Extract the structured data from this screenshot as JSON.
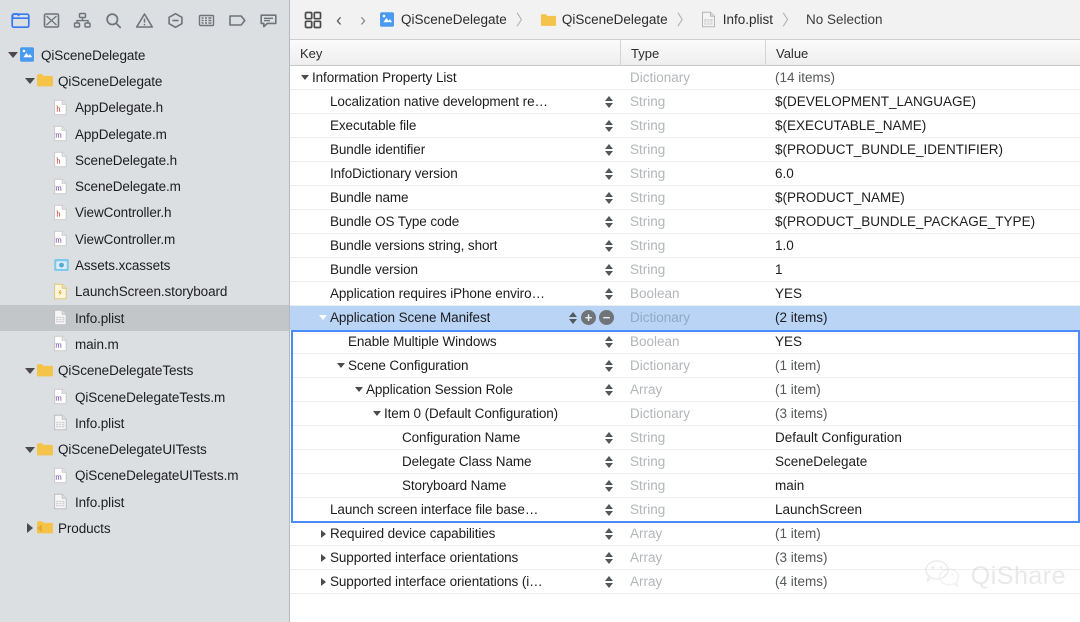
{
  "navigator": {
    "toolbar_tabs": [
      {
        "name": "project-navigator-icon",
        "label": "Project Navigator",
        "active": true
      },
      {
        "name": "source-control-navigator-icon",
        "label": "Source Control Navigator",
        "active": false
      },
      {
        "name": "symbol-navigator-icon",
        "label": "Symbol Navigator",
        "active": false
      },
      {
        "name": "find-navigator-icon",
        "label": "Find Navigator",
        "active": false
      },
      {
        "name": "issue-navigator-icon",
        "label": "Issue Navigator",
        "active": false
      },
      {
        "name": "test-navigator-icon",
        "label": "Test Navigator",
        "active": false
      },
      {
        "name": "debug-navigator-icon",
        "label": "Debug Navigator",
        "active": false
      },
      {
        "name": "breakpoint-navigator-icon",
        "label": "Breakpoint Navigator",
        "active": false
      },
      {
        "name": "report-navigator-icon",
        "label": "Report Navigator",
        "active": false
      }
    ],
    "tree": [
      {
        "label": "QiSceneDelegate",
        "indent": 0,
        "twisty": "down",
        "icon": "xcode-project-icon",
        "selected": false
      },
      {
        "label": "QiSceneDelegate",
        "indent": 1,
        "twisty": "down",
        "icon": "folder-icon",
        "selected": false
      },
      {
        "label": "AppDelegate.h",
        "indent": 2,
        "twisty": "none",
        "icon": "header-file-icon",
        "selected": false
      },
      {
        "label": "AppDelegate.m",
        "indent": 2,
        "twisty": "none",
        "icon": "objc-file-icon",
        "selected": false
      },
      {
        "label": "SceneDelegate.h",
        "indent": 2,
        "twisty": "none",
        "icon": "header-file-icon",
        "selected": false
      },
      {
        "label": "SceneDelegate.m",
        "indent": 2,
        "twisty": "none",
        "icon": "objc-file-icon",
        "selected": false
      },
      {
        "label": "ViewController.h",
        "indent": 2,
        "twisty": "none",
        "icon": "header-file-icon",
        "selected": false
      },
      {
        "label": "ViewController.m",
        "indent": 2,
        "twisty": "none",
        "icon": "objc-file-icon",
        "selected": false
      },
      {
        "label": "Assets.xcassets",
        "indent": 2,
        "twisty": "none",
        "icon": "assets-icon",
        "selected": false
      },
      {
        "label": "LaunchScreen.storyboard",
        "indent": 2,
        "twisty": "none",
        "icon": "storyboard-icon",
        "selected": false
      },
      {
        "label": "Info.plist",
        "indent": 2,
        "twisty": "none",
        "icon": "plist-icon",
        "selected": true
      },
      {
        "label": "main.m",
        "indent": 2,
        "twisty": "none",
        "icon": "objc-file-icon",
        "selected": false
      },
      {
        "label": "QiSceneDelegateTests",
        "indent": 1,
        "twisty": "down",
        "icon": "folder-icon",
        "selected": false
      },
      {
        "label": "QiSceneDelegateTests.m",
        "indent": 2,
        "twisty": "none",
        "icon": "objc-file-icon",
        "selected": false
      },
      {
        "label": "Info.plist",
        "indent": 2,
        "twisty": "none",
        "icon": "plist-icon",
        "selected": false
      },
      {
        "label": "QiSceneDelegateUITests",
        "indent": 1,
        "twisty": "down",
        "icon": "folder-icon",
        "selected": false
      },
      {
        "label": "QiSceneDelegateUITests.m",
        "indent": 2,
        "twisty": "none",
        "icon": "objc-file-icon",
        "selected": false
      },
      {
        "label": "Info.plist",
        "indent": 2,
        "twisty": "none",
        "icon": "plist-icon",
        "selected": false
      },
      {
        "label": "Products",
        "indent": 1,
        "twisty": "right",
        "icon": "folder-build-icon",
        "selected": false
      }
    ]
  },
  "jumpbar": {
    "grid_icon": "related-items-icon",
    "back_label": "‹",
    "forward_label": "›",
    "separator": "〉",
    "crumbs": [
      {
        "label": "QiSceneDelegate",
        "icon": "xcode-project-icon"
      },
      {
        "label": "QiSceneDelegate",
        "icon": "folder-icon"
      },
      {
        "label": "Info.plist",
        "icon": "plist-icon"
      },
      {
        "label": "No Selection",
        "icon": "none"
      }
    ]
  },
  "plist": {
    "columns": [
      "Key",
      "Type",
      "Value"
    ],
    "selection": {
      "first_row_index": 11,
      "last_row_index": 18
    },
    "rows": [
      {
        "key": "Information Property List",
        "indent": 0,
        "twisty": "down",
        "type": "Dictionary",
        "value": "(14 items)",
        "value_dim": true,
        "stepper": false,
        "plusminus": false
      },
      {
        "key": "Localization native development re…",
        "indent": 1,
        "twisty": "none",
        "type": "String",
        "value": "$(DEVELOPMENT_LANGUAGE)",
        "value_dim": false,
        "stepper": true,
        "plusminus": false
      },
      {
        "key": "Executable file",
        "indent": 1,
        "twisty": "none",
        "type": "String",
        "value": "$(EXECUTABLE_NAME)",
        "value_dim": false,
        "stepper": true,
        "plusminus": false
      },
      {
        "key": "Bundle identifier",
        "indent": 1,
        "twisty": "none",
        "type": "String",
        "value": "$(PRODUCT_BUNDLE_IDENTIFIER)",
        "value_dim": false,
        "stepper": true,
        "plusminus": false
      },
      {
        "key": "InfoDictionary version",
        "indent": 1,
        "twisty": "none",
        "type": "String",
        "value": "6.0",
        "value_dim": false,
        "stepper": true,
        "plusminus": false
      },
      {
        "key": "Bundle name",
        "indent": 1,
        "twisty": "none",
        "type": "String",
        "value": "$(PRODUCT_NAME)",
        "value_dim": false,
        "stepper": true,
        "plusminus": false
      },
      {
        "key": "Bundle OS Type code",
        "indent": 1,
        "twisty": "none",
        "type": "String",
        "value": "$(PRODUCT_BUNDLE_PACKAGE_TYPE)",
        "value_dim": false,
        "stepper": true,
        "plusminus": false
      },
      {
        "key": "Bundle versions string, short",
        "indent": 1,
        "twisty": "none",
        "type": "String",
        "value": "1.0",
        "value_dim": false,
        "stepper": true,
        "plusminus": false
      },
      {
        "key": "Bundle version",
        "indent": 1,
        "twisty": "none",
        "type": "String",
        "value": "1",
        "value_dim": false,
        "stepper": true,
        "plusminus": false
      },
      {
        "key": "Application requires iPhone enviro…",
        "indent": 1,
        "twisty": "none",
        "type": "Boolean",
        "value": "YES",
        "value_dim": false,
        "stepper": true,
        "plusminus": false
      },
      {
        "key": "Application Scene Manifest",
        "indent": 1,
        "twisty": "down",
        "type": "Dictionary",
        "value": "(2 items)",
        "value_dim": true,
        "stepper": true,
        "plusminus": true,
        "selected": true
      },
      {
        "key": "Enable Multiple Windows",
        "indent": 2,
        "twisty": "none",
        "type": "Boolean",
        "value": "YES",
        "value_dim": false,
        "stepper": true,
        "plusminus": false
      },
      {
        "key": "Scene Configuration",
        "indent": 2,
        "twisty": "down",
        "type": "Dictionary",
        "value": "(1 item)",
        "value_dim": true,
        "stepper": true,
        "plusminus": false
      },
      {
        "key": "Application Session Role",
        "indent": 3,
        "twisty": "down",
        "type": "Array",
        "value": "(1 item)",
        "value_dim": true,
        "stepper": true,
        "plusminus": false
      },
      {
        "key": "Item 0 (Default Configuration)",
        "indent": 4,
        "twisty": "down",
        "type": "Dictionary",
        "value": "(3 items)",
        "value_dim": true,
        "stepper": false,
        "plusminus": false
      },
      {
        "key": "Configuration Name",
        "indent": 5,
        "twisty": "none",
        "type": "String",
        "value": "Default Configuration",
        "value_dim": false,
        "stepper": true,
        "plusminus": false
      },
      {
        "key": "Delegate Class Name",
        "indent": 5,
        "twisty": "none",
        "type": "String",
        "value": "SceneDelegate",
        "value_dim": false,
        "stepper": true,
        "plusminus": false
      },
      {
        "key": "Storyboard Name",
        "indent": 5,
        "twisty": "none",
        "type": "String",
        "value": "main",
        "value_dim": false,
        "stepper": true,
        "plusminus": false
      },
      {
        "key": "Launch screen interface file base…",
        "indent": 1,
        "twisty": "none",
        "type": "String",
        "value": "LaunchScreen",
        "value_dim": false,
        "stepper": true,
        "plusminus": false
      },
      {
        "key": "Required device capabilities",
        "indent": 1,
        "twisty": "right",
        "type": "Array",
        "value": "(1 item)",
        "value_dim": true,
        "stepper": true,
        "plusminus": false
      },
      {
        "key": "Supported interface orientations",
        "indent": 1,
        "twisty": "right",
        "type": "Array",
        "value": "(3 items)",
        "value_dim": true,
        "stepper": true,
        "plusminus": false
      },
      {
        "key": "Supported interface orientations (i…",
        "indent": 1,
        "twisty": "right",
        "type": "Array",
        "value": "(4 items)",
        "value_dim": true,
        "stepper": true,
        "plusminus": false
      }
    ]
  },
  "watermark": {
    "text": "QiShare",
    "icon": "wechat-icon"
  },
  "colors": {
    "selection_blue": "#b9d4f5",
    "selection_border": "#4a8cf7",
    "accent": "#3478f6",
    "sidebar_bg": "#dcdfe2",
    "sidebar_selected": "#c3c6c9",
    "type_dim": "#b3b6b9"
  }
}
